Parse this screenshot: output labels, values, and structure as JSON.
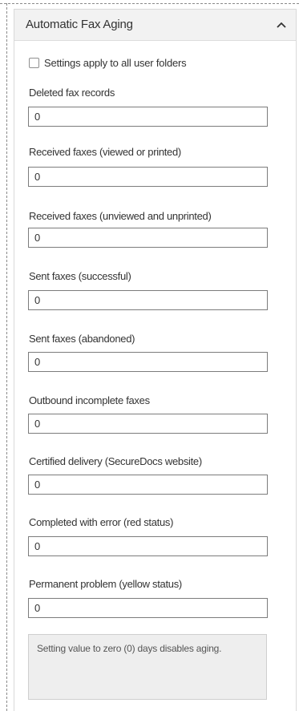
{
  "panel": {
    "title": "Automatic Fax Aging",
    "collapse_icon": "chevron-up-icon"
  },
  "apply_all": {
    "label": "Settings apply to all user folders",
    "checked": false
  },
  "fields": [
    {
      "label": "Deleted fax records",
      "value": "0"
    },
    {
      "label": "Received faxes (viewed or printed)",
      "value": "0"
    },
    {
      "label": "Received faxes (unviewed and unprinted)",
      "value": "0"
    },
    {
      "label": "Sent faxes (successful)",
      "value": "0"
    },
    {
      "label": "Sent faxes (abandoned)",
      "value": "0"
    },
    {
      "label": "Outbound incomplete faxes",
      "value": "0"
    },
    {
      "label": "Certified delivery (SecureDocs website)",
      "value": "0"
    },
    {
      "label": "Completed with error (red status)",
      "value": "0"
    },
    {
      "label": "Permanent problem (yellow status)",
      "value": "0"
    }
  ],
  "notice": "Setting value to zero (0) days disables aging.",
  "colors": {
    "header_bg": "#f2f2f2",
    "notice_bg": "#eeeeee",
    "input_border": "#7c7c7c"
  }
}
